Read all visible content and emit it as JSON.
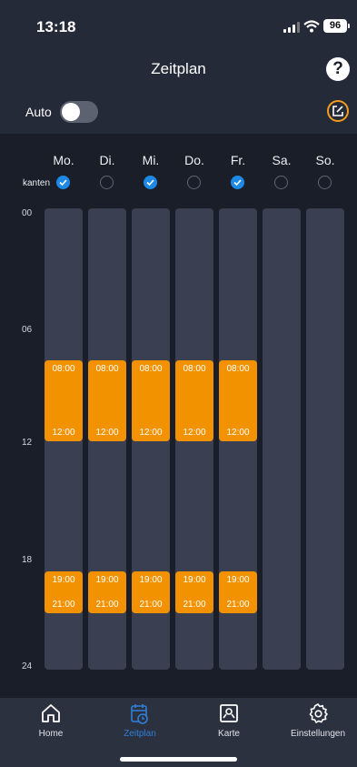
{
  "status_bar": {
    "time": "13:18",
    "battery": "96"
  },
  "header": {
    "title": "Zeitplan",
    "help_label": "?"
  },
  "auto": {
    "label": "Auto",
    "enabled": false
  },
  "schedule": {
    "row_label": "kanten",
    "hour_labels": [
      "00",
      "06",
      "12",
      "18",
      "24"
    ],
    "days": [
      {
        "label": "Mo.",
        "checked": true,
        "slots": [
          {
            "start": "08:00",
            "end": "12:00"
          },
          {
            "start": "19:00",
            "end": "21:00"
          }
        ]
      },
      {
        "label": "Di.",
        "checked": false,
        "slots": [
          {
            "start": "08:00",
            "end": "12:00"
          },
          {
            "start": "19:00",
            "end": "21:00"
          }
        ]
      },
      {
        "label": "Mi.",
        "checked": true,
        "slots": [
          {
            "start": "08:00",
            "end": "12:00"
          },
          {
            "start": "19:00",
            "end": "21:00"
          }
        ]
      },
      {
        "label": "Do.",
        "checked": false,
        "slots": [
          {
            "start": "08:00",
            "end": "12:00"
          },
          {
            "start": "19:00",
            "end": "21:00"
          }
        ]
      },
      {
        "label": "Fr.",
        "checked": true,
        "slots": [
          {
            "start": "08:00",
            "end": "12:00"
          },
          {
            "start": "19:00",
            "end": "21:00"
          }
        ]
      },
      {
        "label": "Sa.",
        "checked": false,
        "slots": []
      },
      {
        "label": "So.",
        "checked": false,
        "slots": []
      }
    ]
  },
  "tabs": [
    {
      "label": "Home",
      "icon": "home-icon",
      "active": false
    },
    {
      "label": "Zeitplan",
      "icon": "calendar-clock-icon",
      "active": true
    },
    {
      "label": "Karte",
      "icon": "map-icon",
      "active": false
    },
    {
      "label": "Einstellungen",
      "icon": "gear-icon",
      "active": false
    }
  ],
  "colors": {
    "accent": "#1e88e5",
    "slot": "#f39200",
    "active_tab": "#2e7fd9",
    "background": "#252a38"
  }
}
